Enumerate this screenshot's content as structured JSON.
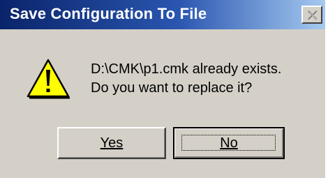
{
  "window": {
    "title": "Save Configuration To File",
    "close_icon": "close-icon"
  },
  "message": {
    "icon": "warning-icon",
    "line1": "D:\\CMK\\p1.cmk already exists.",
    "line2": "Do you want to replace it?"
  },
  "buttons": {
    "yes_label": "Yes",
    "no_label": "No",
    "default": "No"
  },
  "colors": {
    "titlebar_start": "#0a246a",
    "titlebar_end": "#a6caf0",
    "dialog_face": "#d4d0c8",
    "warning_fill": "#ffff00"
  }
}
